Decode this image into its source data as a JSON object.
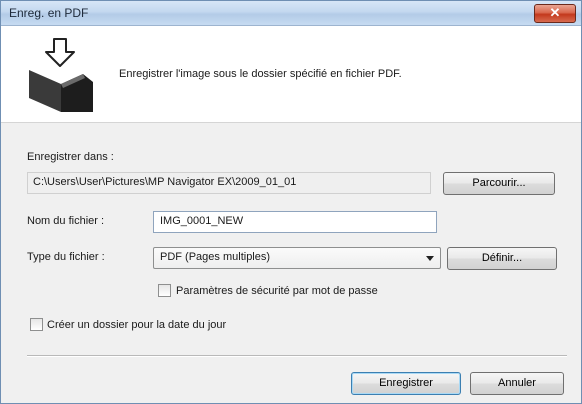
{
  "window": {
    "title": "Enreg. en PDF",
    "close_glyph": "✕"
  },
  "header": {
    "icon": "save-pdf-icon",
    "description": "Enregistrer l'image sous le dossier spécifié en fichier PDF."
  },
  "save_in": {
    "label": "Enregistrer dans :",
    "path": "C:\\Users\\User\\Pictures\\MP Navigator EX\\2009_01_01",
    "browse_label": "Parcourir..."
  },
  "file_name": {
    "label": "Nom du fichier :",
    "value": "IMG_0001_NEW"
  },
  "file_type": {
    "label": "Type du fichier :",
    "selected": "PDF (Pages multiples)",
    "define_label": "Définir..."
  },
  "options": {
    "password_security_label": "Paramètres de sécurité par mot de passe",
    "password_security_checked": false,
    "date_folder_label": "Créer un dossier pour la date du jour",
    "date_folder_checked": false
  },
  "buttons": {
    "save_label": "Enregistrer",
    "cancel_label": "Annuler"
  }
}
